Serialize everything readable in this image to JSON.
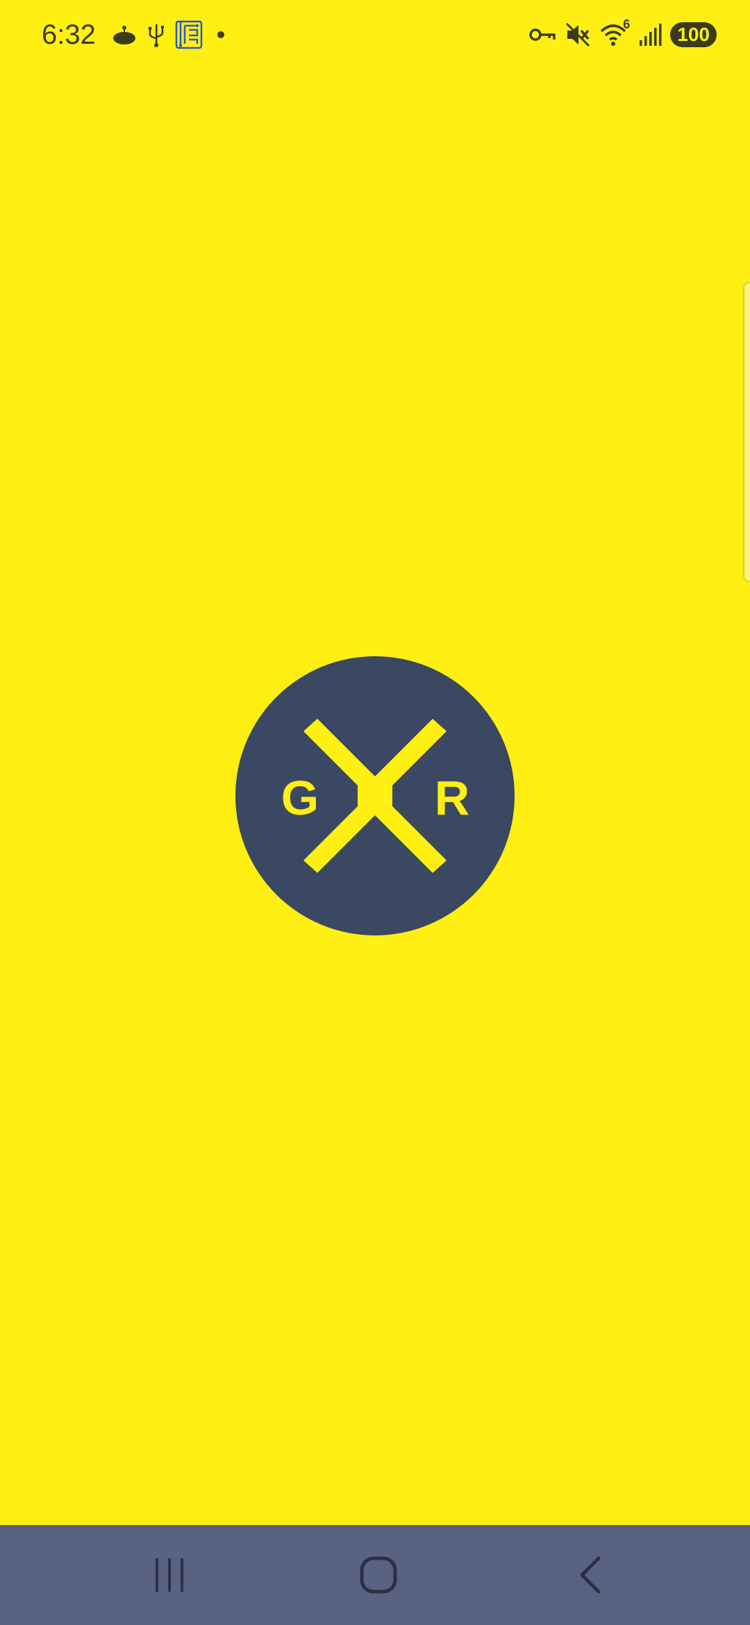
{
  "status_bar": {
    "time": "6:32",
    "signal_superscript": "6",
    "battery": "100",
    "left_icons": [
      "notification-app-icon",
      "usb-icon",
      "grid-app-icon",
      "dot-icon"
    ],
    "right_icons": [
      "vpn-key-icon",
      "mute-icon",
      "wifi-icon",
      "cellular-signal-icon",
      "battery-icon"
    ]
  },
  "logo": {
    "left_letter": "G",
    "right_letter": "R",
    "circle_color": "#3B4861",
    "letter_color": "#FFEF12"
  },
  "colors": {
    "background": "#FFEF12",
    "nav_bar": "#5A6283"
  },
  "nav_bar": {
    "buttons": [
      "recents-icon",
      "home-icon",
      "back-icon"
    ]
  }
}
